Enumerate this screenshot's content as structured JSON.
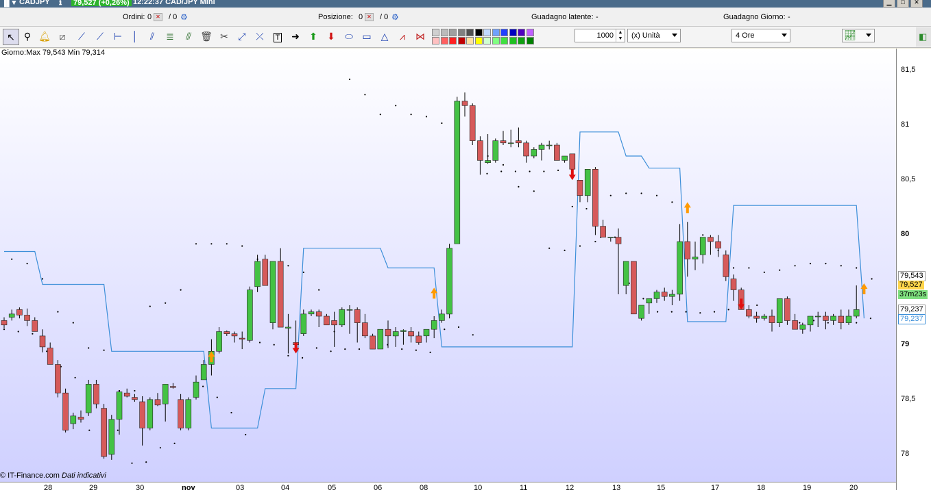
{
  "window": {
    "symbol": "CADJPY",
    "price_change": "79,527 (+0,26%)",
    "title": "12:22:37 CAD/JPY Mini"
  },
  "infobar": {
    "orders_label": "Ordini:",
    "orders_value": "0",
    "orders_slash": "/ 0",
    "position_label": "Posizione:",
    "position_value": "0",
    "position_slash": "/ 0",
    "unrealized_label": "Guadagno latente:",
    "unrealized_value": "-",
    "daily_label": "Guadagno Giorno:",
    "daily_value": "-"
  },
  "toolbar": {
    "icons": [
      "pointer-icon",
      "zoom-icon",
      "alert-bell-icon",
      "ruler-icon",
      "trendline-icon",
      "ray-icon",
      "horizontal-line-icon",
      "vertical-line-icon",
      "parallel-channel-icon",
      "fibonacci-icon",
      "regression-icon",
      "delete-icon",
      "measure-icon",
      "arrow-line-icon",
      "cross-line-icon",
      "text-icon",
      "arrow-right-icon",
      "arrow-up-green-icon",
      "arrow-down-red-icon",
      "ellipse-icon",
      "rectangle-icon",
      "triangle-icon",
      "zigzag-icon",
      "pattern-icon"
    ],
    "quantity": "1000",
    "unit": "(x) Unità",
    "timeframe": "4 Ore",
    "swatch_colors_top": [
      "#d0d0d0",
      "#bbbbbb",
      "#a0a0a0",
      "#808080",
      "#505050",
      "#000000",
      "#c0d8ff",
      "#70a0ff",
      "#2040ff",
      "#0000c0",
      "#5000c0",
      "#c060ff"
    ],
    "swatch_colors_bottom": [
      "#ffc0c0",
      "#ff6060",
      "#ff2020",
      "#c00000",
      "#ffe0a0",
      "#ffff00",
      "#d0ffd0",
      "#80ff80",
      "#40e040",
      "#20c020",
      "#10a010",
      "#008000"
    ]
  },
  "chart": {
    "info_text": "Giorno:Max 79,543 Min 79,314",
    "copyright": "© IT-Finance.com",
    "copyright_note": "Dati indicativi",
    "colors": {
      "bull": "#44c244",
      "bear": "#d65a5a",
      "stop_line": "#3d8fd9",
      "up_arrow": "#ff9a00",
      "down_arrow": "#e01010"
    }
  },
  "axis": {
    "y_ticks": [
      "81,5",
      "81",
      "80,5",
      "80",
      "79",
      "78,5",
      "78"
    ],
    "last_high": "79,543",
    "last_price": "79,527",
    "countdown": "37m23s",
    "last_low": "79,237",
    "stop_value": "79,237",
    "x_ticks": [
      "28",
      "29",
      "30",
      "nov",
      "03",
      "04",
      "05",
      "06",
      "08",
      "10",
      "11",
      "12",
      "13",
      "15",
      "17",
      "18",
      "19",
      "20"
    ]
  },
  "chart_data": {
    "type": "candlestick",
    "ylim": [
      77.75,
      81.7
    ],
    "candles": [
      [
        79.22,
        79.25,
        79.15,
        79.18
      ],
      [
        79.25,
        79.32,
        79.22,
        79.28
      ],
      [
        79.32,
        79.34,
        79.24,
        79.27
      ],
      [
        79.27,
        79.33,
        79.17,
        79.22
      ],
      [
        79.22,
        79.25,
        79.14,
        79.12
      ],
      [
        79.08,
        79.14,
        78.93,
        78.98
      ],
      [
        78.97,
        79.02,
        78.85,
        78.82
      ],
      [
        78.82,
        78.86,
        78.52,
        78.56
      ],
      [
        78.56,
        78.6,
        78.2,
        78.22
      ],
      [
        78.28,
        78.38,
        78.23,
        78.35
      ],
      [
        78.34,
        78.4,
        78.29,
        78.32
      ],
      [
        78.38,
        78.68,
        78.35,
        78.64
      ],
      [
        78.64,
        78.68,
        78.42,
        78.46
      ],
      [
        78.42,
        78.46,
        77.96,
        77.98
      ],
      [
        78.0,
        78.36,
        77.95,
        78.32
      ],
      [
        78.32,
        78.58,
        78.18,
        78.57
      ],
      [
        78.56,
        78.6,
        78.52,
        78.53
      ],
      [
        78.52,
        78.55,
        78.48,
        78.5
      ],
      [
        78.48,
        78.53,
        78.08,
        78.24
      ],
      [
        78.24,
        78.52,
        78.22,
        78.5
      ],
      [
        78.5,
        78.56,
        78.44,
        78.45
      ],
      [
        78.46,
        78.64,
        78.3,
        78.64
      ],
      [
        78.62,
        78.65,
        78.6,
        78.61
      ],
      [
        78.5,
        78.55,
        78.22,
        78.24
      ],
      [
        78.24,
        78.52,
        78.22,
        78.5
      ],
      [
        78.52,
        78.72,
        78.5,
        78.66
      ],
      [
        78.68,
        78.86,
        78.68,
        78.82
      ],
      [
        78.82,
        79.05,
        78.72,
        78.94
      ],
      [
        78.94,
        79.16,
        78.92,
        79.12
      ],
      [
        79.12,
        79.13,
        79.08,
        79.1
      ],
      [
        79.1,
        79.12,
        79.02,
        79.08
      ],
      [
        79.06,
        79.12,
        78.96,
        79.05
      ],
      [
        79.04,
        79.53,
        79.02,
        79.5
      ],
      [
        79.53,
        79.82,
        79.48,
        79.76
      ],
      [
        79.78,
        79.82,
        79.56,
        79.54
      ],
      [
        79.2,
        79.76,
        79.14,
        79.76
      ],
      [
        79.76,
        79.88,
        79.24,
        79.16
      ],
      [
        79.15,
        79.28,
        78.92,
        79.16
      ],
      [
        79.02,
        79.22,
        78.95,
        79.0
      ],
      [
        79.1,
        79.32,
        79.08,
        79.28
      ],
      [
        79.28,
        79.32,
        79.26,
        79.3
      ],
      [
        79.3,
        79.32,
        79.16,
        79.26
      ],
      [
        79.26,
        79.28,
        79.18,
        79.18
      ],
      [
        79.22,
        79.3,
        78.98,
        79.18
      ],
      [
        79.18,
        79.34,
        79.16,
        79.32
      ],
      [
        79.32,
        79.36,
        79.1,
        79.32
      ],
      [
        79.32,
        79.34,
        79.02,
        79.2
      ],
      [
        79.2,
        79.28,
        79.06,
        79.08
      ],
      [
        79.08,
        79.1,
        78.96,
        78.96
      ],
      [
        78.96,
        79.12,
        78.96,
        79.14
      ],
      [
        79.14,
        79.22,
        78.97,
        79.08
      ],
      [
        79.08,
        79.16,
        78.98,
        79.12
      ],
      [
        79.12,
        79.14,
        79.0,
        79.13
      ],
      [
        79.12,
        79.16,
        79.02,
        79.08
      ],
      [
        79.08,
        79.12,
        79.0,
        79.02
      ],
      [
        79.08,
        79.14,
        79.02,
        79.14
      ],
      [
        79.14,
        79.26,
        79.06,
        79.22
      ],
      [
        79.22,
        79.32,
        79.2,
        79.28
      ],
      [
        79.28,
        79.92,
        79.24,
        79.88
      ],
      [
        79.92,
        81.26,
        79.95,
        81.22
      ],
      [
        81.22,
        81.3,
        81.08,
        81.18
      ],
      [
        81.18,
        81.2,
        80.82,
        80.86
      ],
      [
        80.86,
        80.9,
        80.55,
        80.68
      ],
      [
        80.66,
        80.92,
        80.65,
        80.68
      ],
      [
        80.68,
        80.88,
        80.66,
        80.86
      ],
      [
        80.86,
        80.95,
        80.82,
        80.84
      ],
      [
        80.84,
        80.96,
        80.8,
        80.84
      ],
      [
        80.86,
        80.98,
        80.8,
        80.84
      ],
      [
        80.84,
        80.86,
        80.66,
        80.72
      ],
      [
        80.72,
        80.8,
        80.7,
        80.78
      ],
      [
        80.78,
        80.84,
        80.68,
        80.82
      ],
      [
        80.82,
        80.86,
        80.78,
        80.82
      ],
      [
        80.82,
        80.84,
        80.68,
        80.68
      ],
      [
        80.68,
        80.72,
        80.66,
        80.72
      ],
      [
        80.74,
        80.74,
        80.56,
        80.6
      ],
      [
        80.5,
        80.5,
        80.3,
        80.36
      ],
      [
        80.36,
        80.58,
        80.3,
        80.6
      ],
      [
        80.6,
        80.62,
        80.0,
        80.08
      ],
      [
        80.08,
        80.14,
        79.98,
        79.98
      ],
      [
        79.98,
        79.98,
        79.94,
        79.98
      ],
      [
        79.98,
        80.06,
        79.46,
        79.92
      ],
      [
        79.54,
        79.74,
        79.46,
        79.76
      ],
      [
        79.76,
        79.76,
        79.28,
        79.28
      ],
      [
        79.24,
        79.36,
        79.22,
        79.36
      ],
      [
        79.38,
        79.42,
        79.28,
        79.42
      ],
      [
        79.42,
        79.5,
        79.38,
        79.48
      ],
      [
        79.48,
        79.52,
        79.4,
        79.44
      ],
      [
        79.44,
        79.5,
        79.36,
        79.46
      ],
      [
        79.46,
        80.1,
        79.4,
        79.94
      ],
      [
        79.94,
        80.12,
        79.62,
        79.78
      ],
      [
        79.78,
        79.94,
        79.68,
        79.8
      ],
      [
        79.82,
        79.92,
        79.74,
        79.98
      ],
      [
        79.98,
        80.0,
        79.82,
        79.94
      ],
      [
        79.94,
        80.0,
        79.8,
        79.88
      ],
      [
        79.82,
        79.86,
        79.58,
        79.62
      ],
      [
        79.6,
        79.64,
        79.4,
        79.5
      ],
      [
        79.5,
        79.52,
        79.32,
        79.32
      ],
      [
        79.32,
        79.36,
        79.24,
        79.26
      ],
      [
        79.26,
        79.3,
        79.2,
        79.24
      ],
      [
        79.24,
        79.28,
        79.22,
        79.26
      ],
      [
        79.26,
        79.32,
        79.12,
        79.2
      ],
      [
        79.2,
        79.4,
        79.16,
        79.42
      ],
      [
        79.42,
        79.44,
        79.18,
        79.22
      ],
      [
        79.22,
        79.28,
        79.18,
        79.14
      ],
      [
        79.14,
        79.2,
        79.1,
        79.18
      ],
      [
        79.18,
        79.22,
        79.12,
        79.26
      ],
      [
        79.26,
        79.3,
        79.16,
        79.26
      ],
      [
        79.26,
        79.3,
        79.14,
        79.22
      ],
      [
        79.22,
        79.28,
        79.18,
        79.26
      ],
      [
        79.26,
        79.32,
        79.14,
        79.2
      ],
      [
        79.2,
        79.32,
        79.18,
        79.26
      ],
      [
        79.26,
        79.54,
        79.24,
        79.32
      ]
    ],
    "stop_line": [
      [
        0,
        79.85
      ],
      [
        4,
        79.85
      ],
      [
        5,
        79.55
      ],
      [
        13,
        79.55
      ],
      [
        14,
        78.94
      ],
      [
        26,
        78.94
      ],
      [
        27,
        78.24
      ],
      [
        33,
        78.24
      ],
      [
        34,
        78.6
      ],
      [
        38,
        78.6
      ],
      [
        39,
        79.88
      ],
      [
        49,
        79.88
      ],
      [
        50,
        79.7
      ],
      [
        56,
        79.7
      ],
      [
        57,
        78.98
      ],
      [
        74,
        78.98
      ],
      [
        75,
        80.94
      ],
      [
        80,
        80.94
      ],
      [
        81,
        80.72
      ],
      [
        83,
        80.72
      ],
      [
        84,
        80.61
      ],
      [
        88,
        80.61
      ],
      [
        89,
        79.21
      ],
      [
        94,
        79.21
      ],
      [
        95,
        80.27
      ],
      [
        111,
        80.27
      ],
      [
        112,
        79.24
      ]
    ],
    "dots_upper": [
      79.78,
      79.74,
      79.6,
      79.3,
      79.2,
      78.97,
      78.95,
      78.58,
      78.58,
      79.35,
      79.38,
      79.5,
      79.92,
      79.92,
      79.92,
      79.9,
      79.78,
      79.74,
      79.72,
      79.66,
      79.5,
      79.12,
      81.42,
      81.28,
      81.1,
      81.18,
      81.1,
      81.08,
      81.02,
      80.98,
      80.96,
      80.72,
      80.64,
      80.44,
      80.4,
      79.88,
      79.86,
      79.9,
      79.94,
      80.36,
      80.38,
      80.38,
      80.36,
      80.3,
      80.26,
      80.0,
      79.86,
      79.7,
      79.7,
      79.66,
      79.68,
      79.72,
      79.74,
      79.74,
      79.72,
      79.7,
      79.6
    ],
    "dots_lower": [
      79.14,
      79.12,
      79.1,
      78.94,
      78.8,
      78.7,
      78.22,
      78.22,
      78.22,
      77.92,
      77.93,
      78.06,
      78.1,
      78.48,
      78.62,
      78.52,
      78.38,
      78.18,
      79.02,
      79.0,
      78.9,
      78.88,
      78.97,
      78.94,
      78.96,
      78.96,
      78.97,
      79.0,
      78.96,
      78.95,
      78.93,
      79.14,
      79.16,
      79.09,
      80.56,
      80.58,
      80.58,
      80.58,
      80.58,
      80.59,
      80.26,
      80.24,
      79.98,
      79.98,
      79.56,
      79.42,
      79.3,
      79.3,
      79.3,
      79.29,
      79.3,
      79.32,
      79.34,
      79.36,
      79.24,
      79.26,
      79.2,
      79.22,
      79.2,
      79.22,
      79.2,
      79.24
    ]
  }
}
